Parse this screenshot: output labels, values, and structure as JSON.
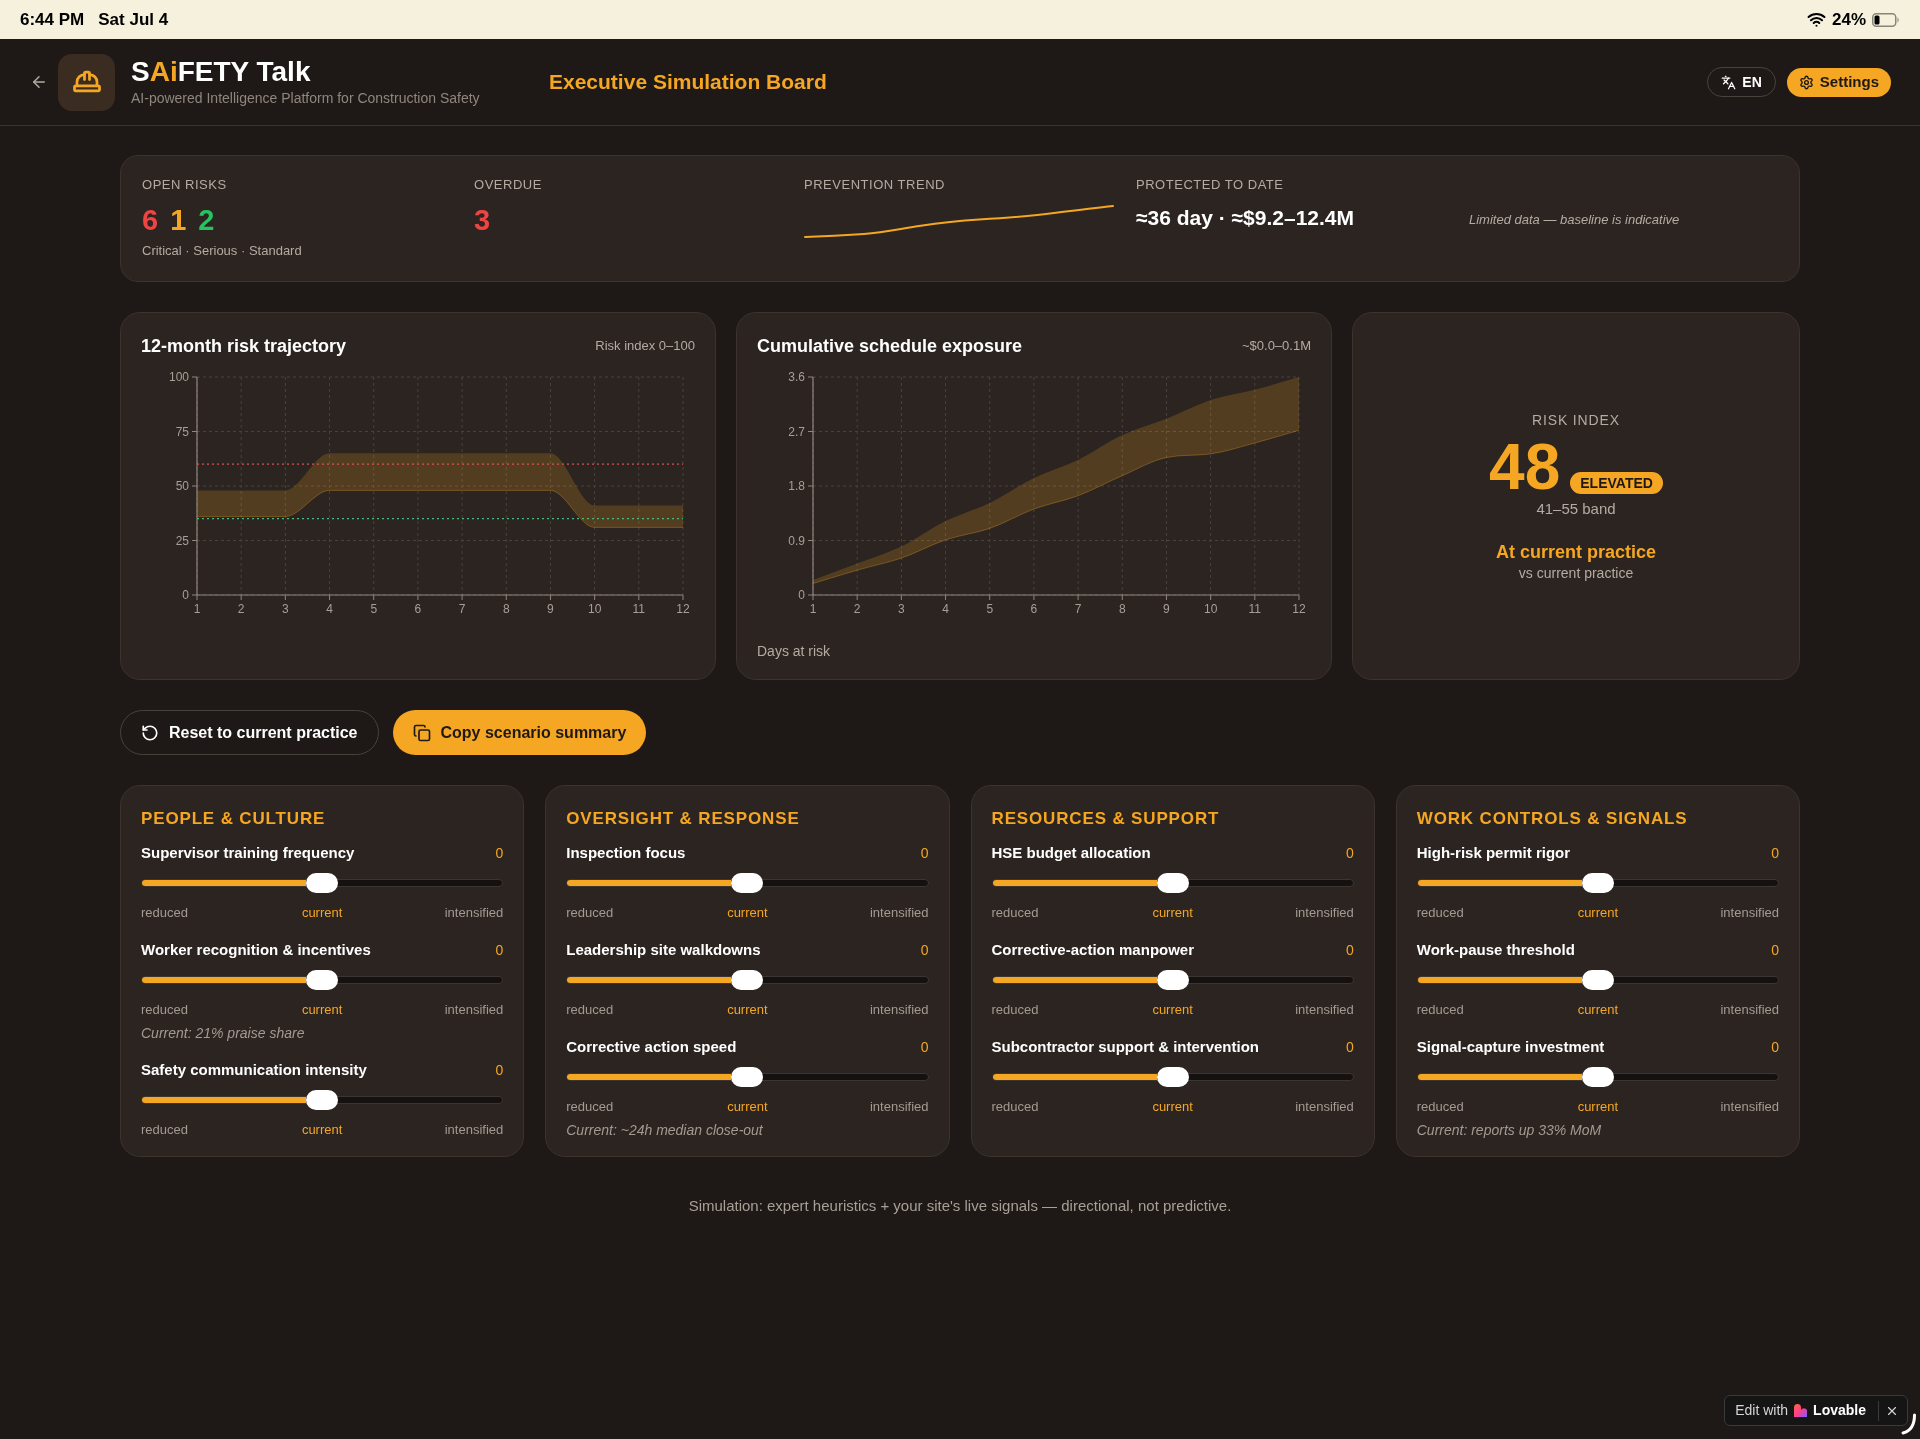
{
  "status_bar": {
    "time": "6:44 PM",
    "date": "Sat Jul 4",
    "battery": "24%"
  },
  "header": {
    "title_parts": [
      {
        "text": "S",
        "accent": false
      },
      {
        "text": "Ai",
        "accent": true
      },
      {
        "text": "FETY Talk",
        "accent": false
      }
    ],
    "subtitle": "AI-powered Intelligence Platform for Construction Safety",
    "page_title": "Executive Simulation Board",
    "language_button": "EN",
    "settings_button": "Settings"
  },
  "summary": {
    "open_risks": {
      "label": "OPEN RISKS",
      "counts": [
        {
          "value": "6",
          "color": "#ef4444"
        },
        {
          "value": "1",
          "color": "#f5a623"
        },
        {
          "value": "2",
          "color": "#22c55e"
        }
      ],
      "caption": "Critical · Serious · Standard"
    },
    "overdue": {
      "label": "OVERDUE",
      "value": "3"
    },
    "prevention_trend": {
      "label": "PREVENTION TREND"
    },
    "protected_to_date": {
      "label": "PROTECTED TO DATE",
      "value": "≈36 day · ≈$9.2–12.4M"
    },
    "note": "Limited data — baseline is indicative"
  },
  "trajectory_card": {
    "range_note": "Risk index 0–100",
    "chart_data": {
      "type": "area",
      "title": "12-month risk trajectory",
      "x": [
        1,
        2,
        3,
        4,
        5,
        6,
        7,
        8,
        9,
        10,
        11,
        12
      ],
      "xlim": [
        1,
        12
      ],
      "ylim": [
        0,
        100
      ],
      "xticks": [
        1,
        2,
        3,
        4,
        5,
        6,
        7,
        8,
        9,
        10,
        11,
        12
      ],
      "yticks": [
        0,
        25,
        50,
        75,
        100
      ],
      "grid": true,
      "series": [
        {
          "type": "area",
          "color": "#f5a623",
          "values": [
            48,
            48,
            48,
            65,
            65,
            65,
            65,
            65,
            65,
            41,
            41,
            41
          ]
        },
        {
          "type": "line",
          "color": "#f5a623",
          "values": [
            36,
            36,
            36,
            48,
            48,
            48,
            48,
            48,
            48,
            31,
            31,
            31
          ]
        }
      ],
      "ref_lines": [
        {
          "axis": "y",
          "value": 60,
          "color": "#d9534f"
        },
        {
          "axis": "y",
          "value": 35,
          "color": "#3fbf7f"
        }
      ]
    }
  },
  "exposure_card": {
    "range_note": "~$0.0–0.1M",
    "chart_data": {
      "type": "area",
      "title": "Cumulative schedule exposure",
      "ylabel": "Days at risk",
      "x": [
        1,
        2,
        3,
        4,
        5,
        6,
        7,
        8,
        9,
        10,
        11,
        12
      ],
      "xlim": [
        1,
        12
      ],
      "ylim": [
        0,
        3.6
      ],
      "xticks": [
        1,
        2,
        3,
        4,
        5,
        6,
        7,
        8,
        9,
        10,
        11,
        12
      ],
      "yticks": [
        0,
        0.9,
        1.8,
        2.7,
        3.6
      ],
      "grid": true,
      "series": [
        {
          "type": "area",
          "color": "#f5a623",
          "values": [
            0.25,
            0.52,
            0.8,
            1.22,
            1.52,
            1.93,
            2.23,
            2.64,
            2.91,
            3.22,
            3.39,
            3.6
          ]
        },
        {
          "type": "line",
          "color": "#f5a623",
          "values": [
            0.19,
            0.41,
            0.61,
            0.91,
            1.1,
            1.42,
            1.64,
            1.97,
            2.27,
            2.33,
            2.51,
            2.72
          ]
        }
      ]
    }
  },
  "risk_index": {
    "label": "RISK INDEX",
    "value": "48",
    "badge": "ELEVATED",
    "band": "41–55 band",
    "scenario": "At current practice",
    "comparison": "vs current practice"
  },
  "actions": [
    {
      "kind": "reset",
      "label": "Reset to current practice"
    },
    {
      "kind": "copy",
      "label": "Copy scenario summary"
    }
  ],
  "panels": [
    {
      "title": "PEOPLE & CULTURE",
      "sliders": [
        {
          "label": "Supervisor training frequency",
          "value": "0",
          "level": 0.5,
          "scale": {
            "low": "reduced",
            "mid": "current",
            "high": "intensified"
          }
        },
        {
          "label": "Worker recognition & incentives",
          "value": "0",
          "level": 0.5,
          "scale": {
            "low": "reduced",
            "mid": "current",
            "high": "intensified"
          },
          "note": "Current: 21% praise share"
        },
        {
          "label": "Safety communication intensity",
          "value": "0",
          "level": 0.5,
          "scale": {
            "low": "reduced",
            "mid": "current",
            "high": "intensified"
          }
        }
      ]
    },
    {
      "title": "OVERSIGHT & RESPONSE",
      "sliders": [
        {
          "label": "Inspection focus",
          "value": "0",
          "level": 0.5,
          "scale": {
            "low": "reduced",
            "mid": "current",
            "high": "intensified"
          }
        },
        {
          "label": "Leadership site walkdowns",
          "value": "0",
          "level": 0.5,
          "scale": {
            "low": "reduced",
            "mid": "current",
            "high": "intensified"
          }
        },
        {
          "label": "Corrective action speed",
          "value": "0",
          "level": 0.5,
          "scale": {
            "low": "reduced",
            "mid": "current",
            "high": "intensified"
          },
          "note": "Current: ~24h median close-out"
        }
      ]
    },
    {
      "title": "RESOURCES & SUPPORT",
      "sliders": [
        {
          "label": "HSE budget allocation",
          "value": "0",
          "level": 0.5,
          "scale": {
            "low": "reduced",
            "mid": "current",
            "high": "intensified"
          }
        },
        {
          "label": "Corrective-action manpower",
          "value": "0",
          "level": 0.5,
          "scale": {
            "low": "reduced",
            "mid": "current",
            "high": "intensified"
          }
        },
        {
          "label": "Subcontractor support & intervention",
          "value": "0",
          "level": 0.5,
          "scale": {
            "low": "reduced",
            "mid": "current",
            "high": "intensified"
          }
        }
      ]
    },
    {
      "title": "WORK CONTROLS & SIGNALS",
      "sliders": [
        {
          "label": "High-risk permit rigor",
          "value": "0",
          "level": 0.5,
          "scale": {
            "low": "reduced",
            "mid": "current",
            "high": "intensified"
          }
        },
        {
          "label": "Work-pause threshold",
          "value": "0",
          "level": 0.5,
          "scale": {
            "low": "reduced",
            "mid": "current",
            "high": "intensified"
          }
        },
        {
          "label": "Signal-capture investment",
          "value": "0",
          "level": 0.5,
          "scale": {
            "low": "reduced",
            "mid": "current",
            "high": "intensified"
          },
          "note": "Current: reports up 33% MoM"
        }
      ]
    }
  ],
  "footer": "Simulation: expert heuristics + your site's live signals — directional, not predictive.",
  "edit_badge": {
    "prefix": "Edit with",
    "brand": "Lovable"
  }
}
